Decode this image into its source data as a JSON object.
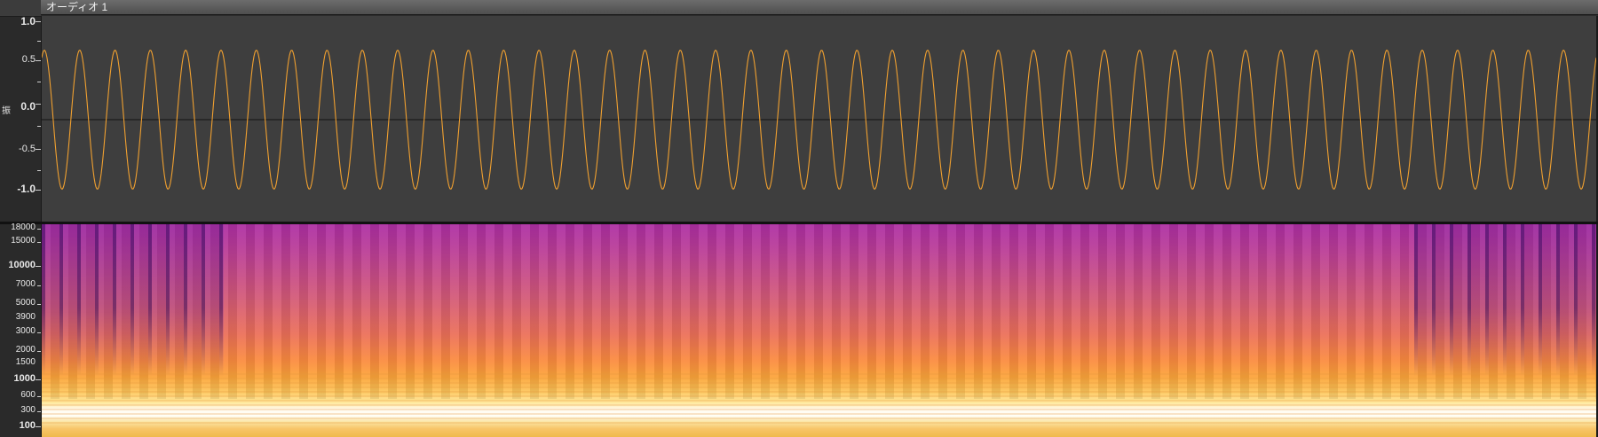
{
  "track": {
    "name": "オーディオ 1"
  },
  "waveform": {
    "y_axis_labels": [
      "1.0",
      "0.5",
      "0.0",
      "-0.5",
      "-1.0"
    ],
    "y_axis_unit": "振",
    "wave_color": "#f0a030",
    "zero_line_color": "#111111",
    "background_color": "#3e3e3e",
    "cycles_visible": 44,
    "amplitude": 0.8
  },
  "spectrogram": {
    "freq_labels": [
      "18000",
      "15000",
      "10000",
      "7000",
      "5000",
      "3900",
      "3000",
      "2000",
      "1500",
      "1000",
      "600",
      "300",
      "100"
    ],
    "colormap": [
      "#ad2ea3",
      "#d45a77",
      "#fb8b3f",
      "#fdc75c",
      "#fffef7"
    ]
  }
}
